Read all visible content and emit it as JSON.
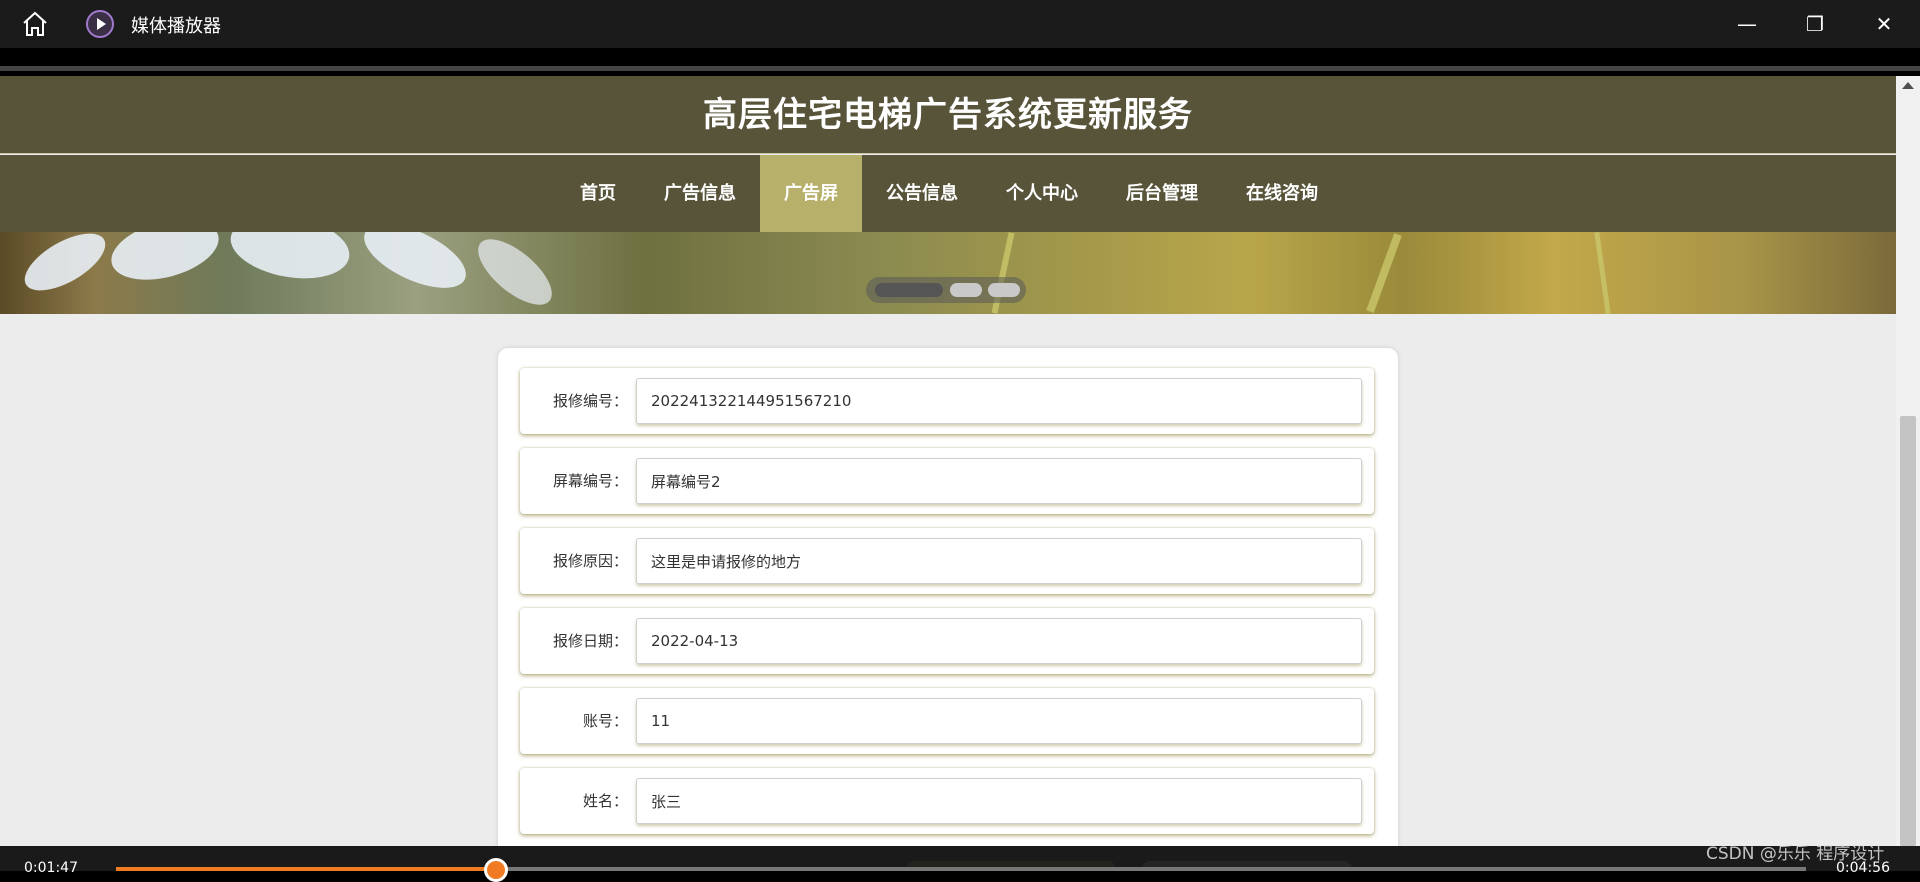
{
  "window": {
    "app_title": "媒体播放器",
    "minimize_glyph": "—",
    "maximize_glyph": "❐",
    "close_glyph": "✕"
  },
  "site": {
    "title": "高层住宅电梯广告系统更新服务",
    "nav": [
      {
        "label": "首页",
        "active": false
      },
      {
        "label": "广告信息",
        "active": false
      },
      {
        "label": "广告屏",
        "active": true
      },
      {
        "label": "公告信息",
        "active": false
      },
      {
        "label": "个人中心",
        "active": false
      },
      {
        "label": "后台管理",
        "active": false
      },
      {
        "label": "在线咨询",
        "active": false
      }
    ]
  },
  "form": {
    "rows": [
      {
        "label": "报修编号：",
        "value": "202241322144951567210"
      },
      {
        "label": "屏幕编号：",
        "value": "屏幕编号2"
      },
      {
        "label": "报修原因：",
        "value": "这里是申请报修的地方"
      },
      {
        "label": "报修日期：",
        "value": "2022-04-13"
      },
      {
        "label": "账号：",
        "value": "11"
      },
      {
        "label": "姓名：",
        "value": "张三"
      }
    ]
  },
  "player": {
    "current_time": "0:01:47",
    "total_time": "0:04:56",
    "progress": 0.225
  },
  "watermark": "CSDN @乐乐 程序设计",
  "colors": {
    "header_bg": "#57543a",
    "nav_active": "#b7b06b",
    "progress": "#f07b23"
  }
}
